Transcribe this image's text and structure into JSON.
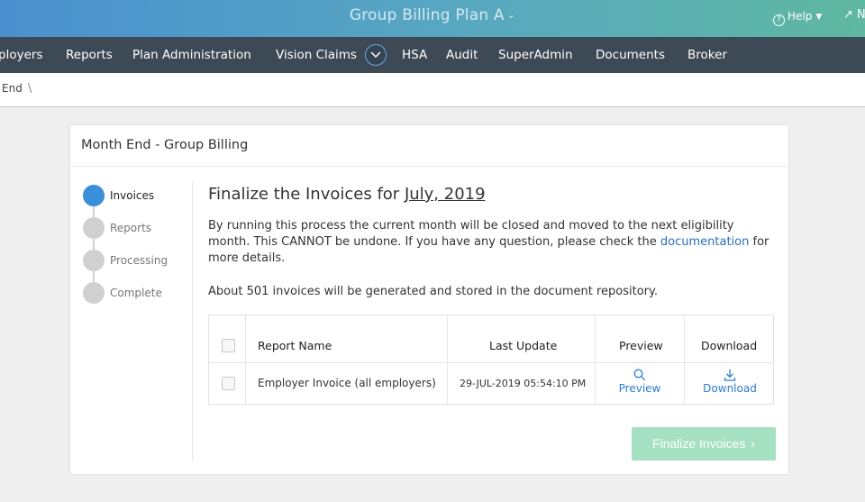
{
  "topbar": {
    "title": "Group Billing Plan A",
    "help_label": "Help",
    "ext_label": "N"
  },
  "nav": {
    "items": [
      "ployers",
      "Reports",
      "Plan Administration",
      "Vision Claims",
      "HSA",
      "Audit",
      "SuperAdmin",
      "Documents",
      "Broker"
    ]
  },
  "breadcrumb": {
    "current": "End",
    "separator": "\\"
  },
  "card": {
    "title": "Month End - Group Billing"
  },
  "steps": [
    {
      "label": "Invoices",
      "active": true
    },
    {
      "label": "Reports",
      "active": false
    },
    {
      "label": "Processing",
      "active": false
    },
    {
      "label": "Complete",
      "active": false
    }
  ],
  "main": {
    "heading_prefix": "Finalize the Invoices for",
    "heading_month": "July, 2019",
    "desc_before": "By running this process the current month will be closed and moved to the next eligibility month. This CANNOT be undone. If you have any question, please check the",
    "desc_link": "documentation",
    "desc_after": "for more details.",
    "summary": "About 501 invoices will be generated and stored in the document repository."
  },
  "table": {
    "headers": {
      "report_name": "Report Name",
      "last_update": "Last Update",
      "preview": "Preview",
      "download": "Download"
    },
    "rows": [
      {
        "report_name": "Employer Invoice (all employers)",
        "last_update": "29-JUL-2019 05:54:10 PM",
        "preview_label": "Preview",
        "download_label": "Download"
      }
    ]
  },
  "actions": {
    "finalize_label": "Finalize Invoices"
  },
  "colors": {
    "accent": "#3a8fd9",
    "nav_bg": "#3d4954",
    "finalize_bg": "#a6e0c2",
    "link": "#2a7dd1"
  }
}
